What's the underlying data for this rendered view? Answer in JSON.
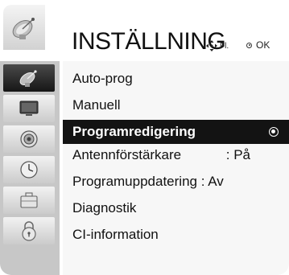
{
  "header": {
    "title": "INSTÄLLNING",
    "nav_hint_label": "Fl.",
    "ok_hint_label": "OK"
  },
  "left_tabs": [
    {
      "icon": "satellite-dish-icon",
      "active": true
    },
    {
      "icon": "tv-screen-icon",
      "active": false
    },
    {
      "icon": "speaker-icon",
      "active": false
    },
    {
      "icon": "clock-icon",
      "active": false
    },
    {
      "icon": "toolbox-icon",
      "active": false
    },
    {
      "icon": "lock-icon",
      "active": false
    }
  ],
  "menu": {
    "items": [
      {
        "label": "Auto-prog"
      },
      {
        "label": "Manuell"
      },
      {
        "label": "Programredigering",
        "selected": true
      },
      {
        "label": "Antennförstärkare",
        "value": ": På"
      },
      {
        "label": "Programuppdatering : Av"
      },
      {
        "label": "Diagnostik"
      },
      {
        "label": "CI-information"
      }
    ]
  },
  "colors": {
    "selected_bg": "#131313",
    "sidebar_bg": "#c7c7c7",
    "list_bg": "#f7f7f7"
  }
}
